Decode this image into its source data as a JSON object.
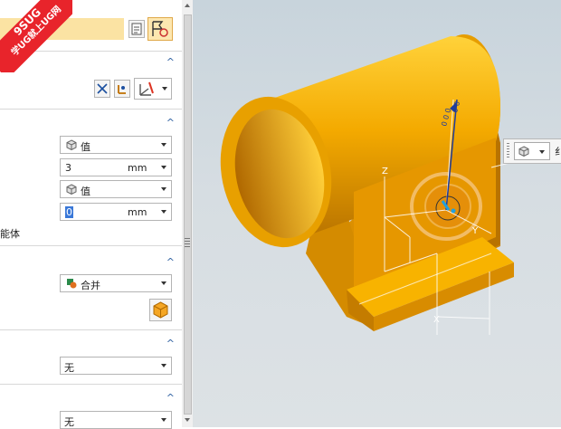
{
  "watermark": {
    "line1": "9SUG",
    "line2": "学UG就上UG网"
  },
  "panel": {
    "top_field_value": "",
    "limits": {
      "start_mode": "值",
      "start_value": "3",
      "start_unit": "mm",
      "end_mode": "值",
      "end_value": "0",
      "end_unit": "mm",
      "open_profile_label": "能体"
    },
    "boolean": {
      "value": "合并"
    },
    "draft": {
      "value": "无"
    },
    "offset": {
      "value": "无"
    }
  },
  "viewport": {
    "axis_z": "Z",
    "axis_y": "Y",
    "dim_x": "X",
    "float_toolbar_text": "纟",
    "colors": {
      "part": "#f2a800",
      "part_dark": "#c77a00",
      "part_light": "#ffc829",
      "handle": "#e8a040"
    }
  }
}
